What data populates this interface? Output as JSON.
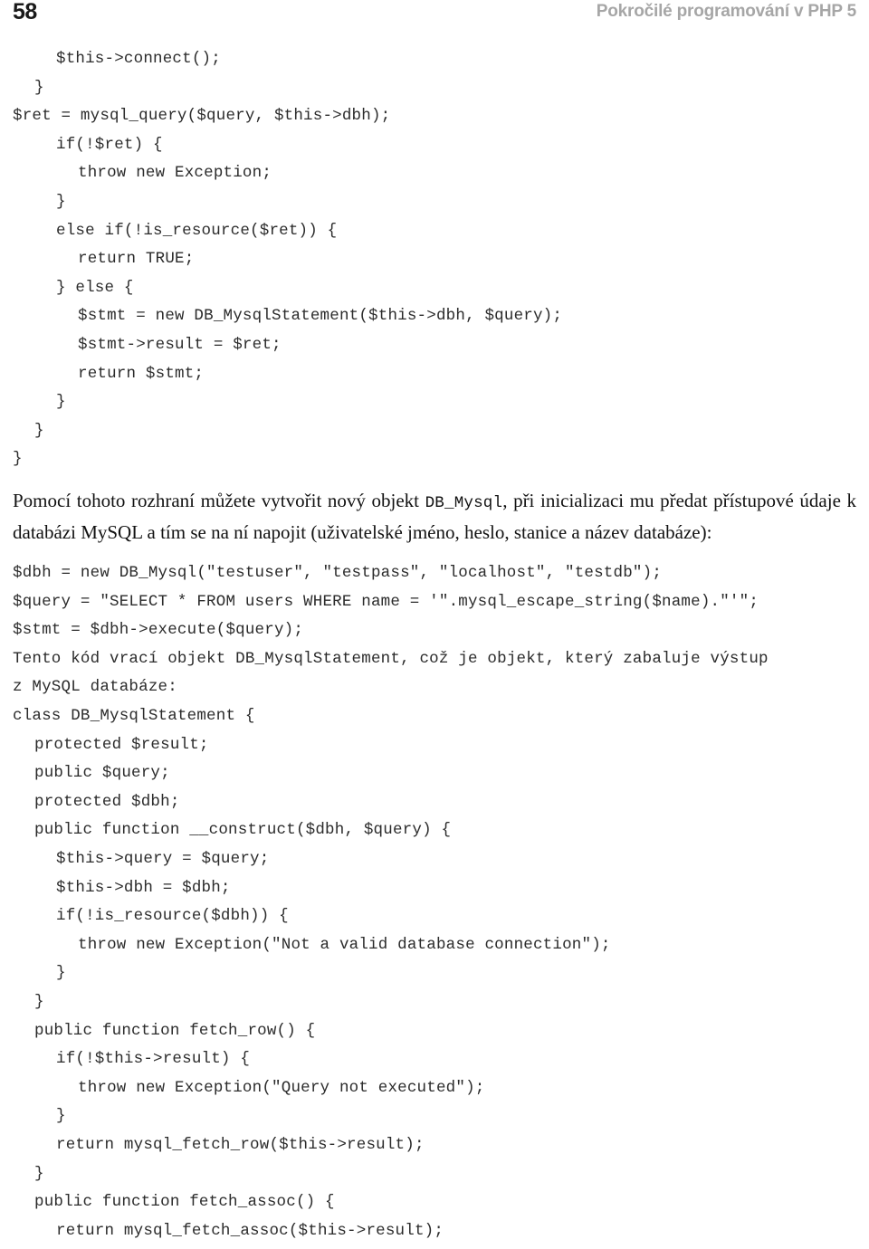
{
  "header": {
    "folio": "58",
    "running_title": "Pokročilé programování v PHP 5"
  },
  "content": {
    "code_block_1": [
      {
        "indent": 2,
        "text": "$this->connect();"
      },
      {
        "indent": 1,
        "text": "}"
      },
      {
        "indent": 0,
        "text": "$ret = mysql_query($query, $this->dbh);"
      },
      {
        "indent": 2,
        "text": "if(!$ret) {"
      },
      {
        "indent": 3,
        "text": "throw new Exception;"
      },
      {
        "indent": 2,
        "text": "}"
      },
      {
        "indent": 2,
        "text": "else if(!is_resource($ret)) {"
      },
      {
        "indent": 3,
        "text": "return TRUE;"
      },
      {
        "indent": 2,
        "text": "} else {"
      },
      {
        "indent": 3,
        "text": "$stmt = new DB_MysqlStatement($this->dbh, $query);"
      },
      {
        "indent": 3,
        "text": "$stmt->result = $ret;"
      },
      {
        "indent": 3,
        "text": "return $stmt;"
      },
      {
        "indent": 2,
        "text": "}"
      },
      {
        "indent": 1,
        "text": "}"
      },
      {
        "indent": 0,
        "text": "}"
      }
    ],
    "paragraph_1": {
      "part_1": "Pomocí tohoto rozhraní můžete vytvořit nový objekt ",
      "code_1": "DB_Mysql",
      "part_2": ", při inicializaci mu předat přístupové údaje k databázi MySQL a tím se na ní napojit (uživatelské jméno, heslo, stanice a název databáze):"
    },
    "code_block_2": [
      {
        "indent": 0,
        "text": "$dbh = new DB_Mysql(\"testuser\", \"testpass\", \"localhost\", \"testdb\");"
      },
      {
        "indent": 0,
        "text": "$query = \"SELECT * FROM users WHERE name = '\".mysql_escape_string($name).\"'\";"
      },
      {
        "indent": 0,
        "text": "$stmt = $dbh->execute($query);"
      },
      {
        "indent": 0,
        "text": "Tento kód vrací objekt DB_MysqlStatement, což je objekt, který zabaluje výstup"
      },
      {
        "indent": 0,
        "text": "z MySQL databáze:"
      },
      {
        "indent": 0,
        "text": "class DB_MysqlStatement {"
      },
      {
        "indent": 1,
        "text": "protected $result;"
      },
      {
        "indent": 1,
        "text": "public $query;"
      },
      {
        "indent": 1,
        "text": "protected $dbh;"
      },
      {
        "indent": 1,
        "text": "public function __construct($dbh, $query) {"
      },
      {
        "indent": 2,
        "text": "$this->query = $query;"
      },
      {
        "indent": 2,
        "text": "$this->dbh = $dbh;"
      },
      {
        "indent": 2,
        "text": "if(!is_resource($dbh)) {"
      },
      {
        "indent": 3,
        "text": "throw new Exception(\"Not a valid database connection\");"
      },
      {
        "indent": 2,
        "text": "}"
      },
      {
        "indent": 1,
        "text": "}"
      },
      {
        "indent": 1,
        "text": "public function fetch_row() {"
      },
      {
        "indent": 2,
        "text": "if(!$this->result) {"
      },
      {
        "indent": 3,
        "text": "throw new Exception(\"Query not executed\");"
      },
      {
        "indent": 2,
        "text": "}"
      },
      {
        "indent": 2,
        "text": "return mysql_fetch_row($this->result);"
      },
      {
        "indent": 1,
        "text": "}"
      },
      {
        "indent": 1,
        "text": "public function fetch_assoc() {"
      },
      {
        "indent": 2,
        "text": "return mysql_fetch_assoc($this->result);"
      }
    ]
  }
}
